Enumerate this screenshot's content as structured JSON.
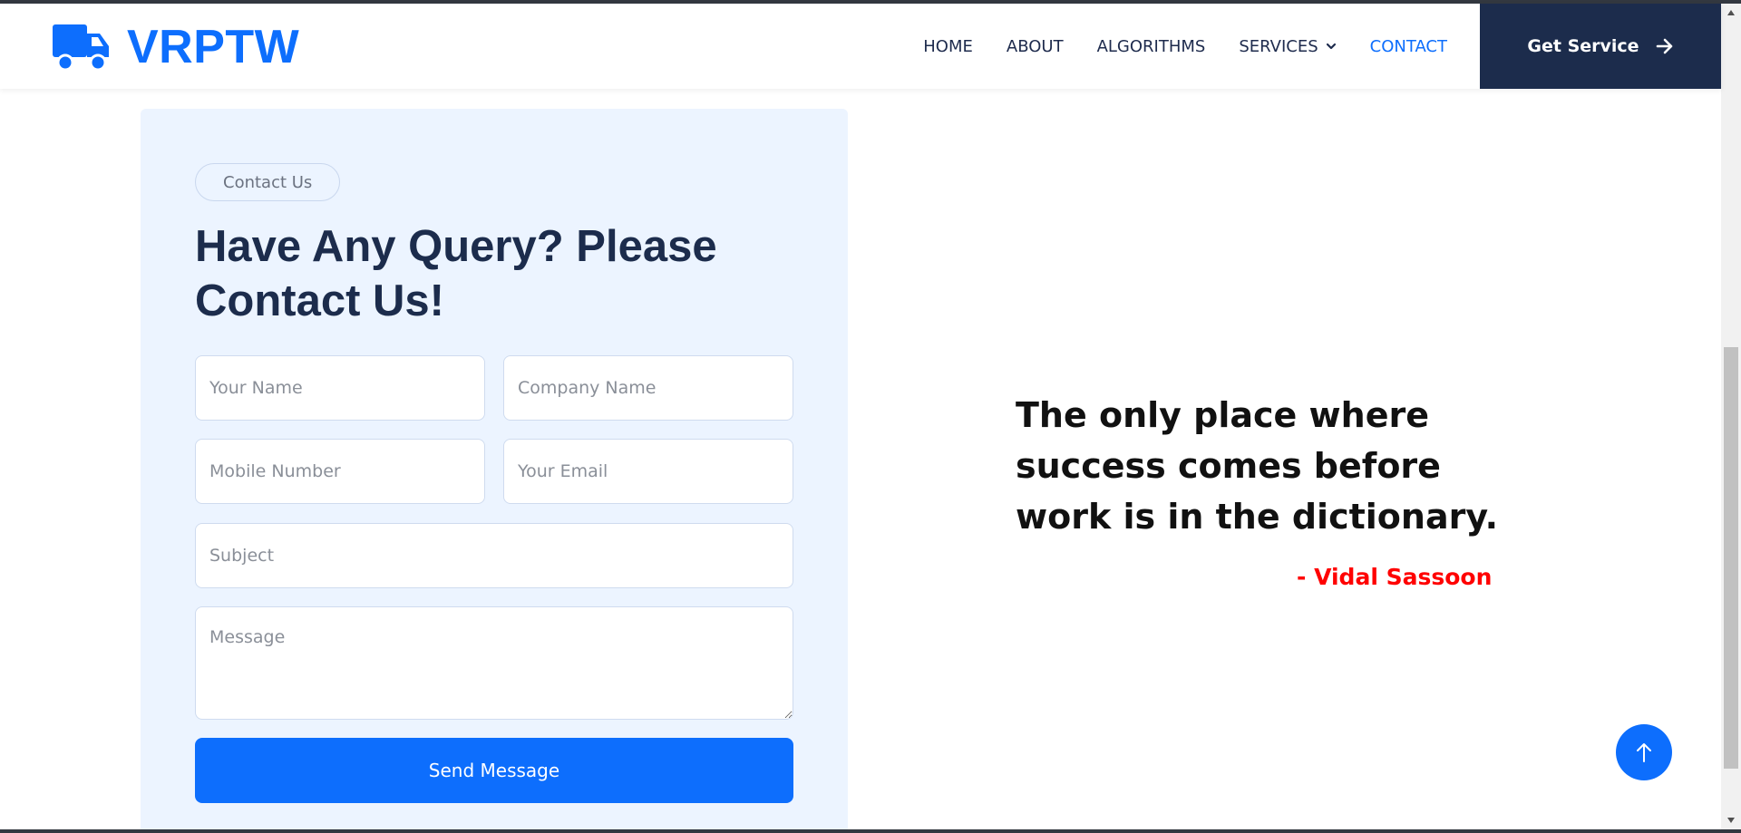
{
  "brand": {
    "name": "VRPTW",
    "icon": "truck-icon"
  },
  "nav": {
    "items": [
      {
        "label": "HOME"
      },
      {
        "label": "ABOUT"
      },
      {
        "label": "ALGORITHMS"
      },
      {
        "label": "SERVICES"
      },
      {
        "label": "CONTACT"
      }
    ],
    "active": "CONTACT",
    "cta_label": "Get Service"
  },
  "contact": {
    "pill": "Contact Us",
    "heading": "Have Any Query? Please Contact Us!",
    "fields": {
      "name": "Your Name",
      "company": "Company Name",
      "mobile": "Mobile Number",
      "email": "Your Email",
      "subject": "Subject",
      "message": "Message"
    },
    "submit_label": "Send Message"
  },
  "quote": {
    "text": "The only place where success comes before work is in the dictionary.",
    "author": "- Vidal Sassoon"
  },
  "colors": {
    "primary": "#0d6efd",
    "dark": "#1c2c4c",
    "panel": "#ecf4ff",
    "author": "#ff0000"
  }
}
